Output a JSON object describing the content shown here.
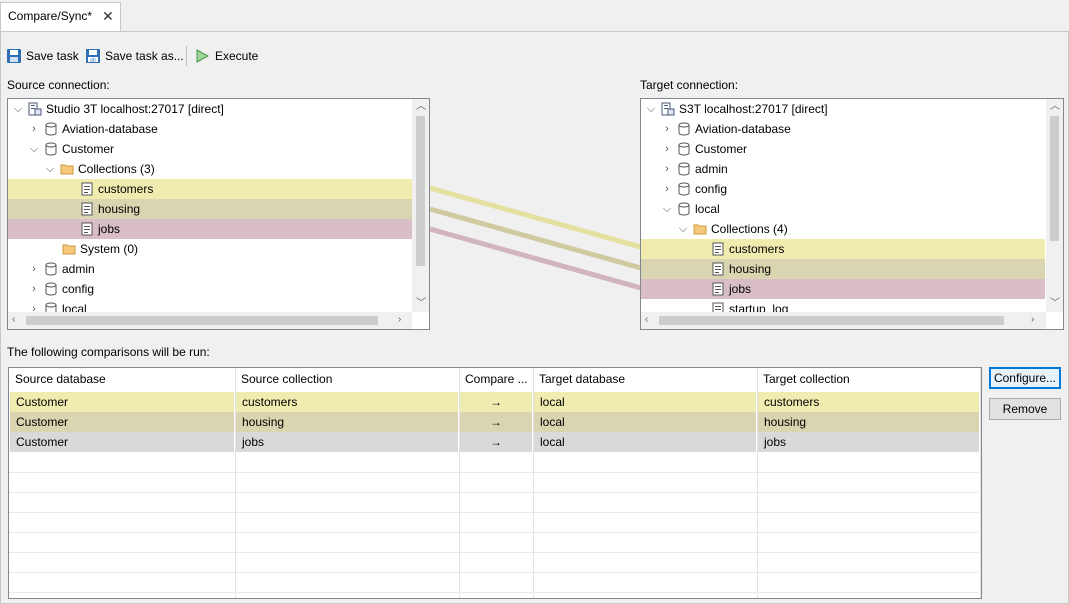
{
  "tab": {
    "title": "Compare/Sync*"
  },
  "toolbar": {
    "save_task": "Save task",
    "save_task_as": "Save task as...",
    "execute": "Execute"
  },
  "source": {
    "label": "Source connection:",
    "rows": [
      "Studio 3T localhost:27017 [direct]",
      "Aviation-database",
      "Customer",
      "Collections (3)",
      "customers",
      "housing",
      "jobs",
      "System (0)",
      "admin",
      "config",
      "local"
    ]
  },
  "target": {
    "label": "Target connection:",
    "rows": [
      "S3T localhost:27017 [direct]",
      "Aviation-database",
      "Customer",
      "admin",
      "config",
      "local",
      "Collections (4)",
      "customers",
      "housing",
      "jobs",
      "startup_log"
    ]
  },
  "comparisons": {
    "label": "The following comparisons will be run:",
    "headers": [
      "Source database",
      "Source collection",
      "Compare ...",
      "Target database",
      "Target collection"
    ],
    "rows": [
      [
        "Customer",
        "customers",
        "→",
        "local",
        "customers"
      ],
      [
        "Customer",
        "housing",
        "→",
        "local",
        "housing"
      ],
      [
        "Customer",
        "jobs",
        "→",
        "local",
        "jobs"
      ]
    ]
  },
  "buttons": {
    "configure": "Configure...",
    "remove": "Remove"
  },
  "colors": {
    "yellow": "#f0ecb0",
    "khaki": "#d9d5b0",
    "pink": "#d9bec8",
    "selected_grey": "#d9d9d9"
  }
}
